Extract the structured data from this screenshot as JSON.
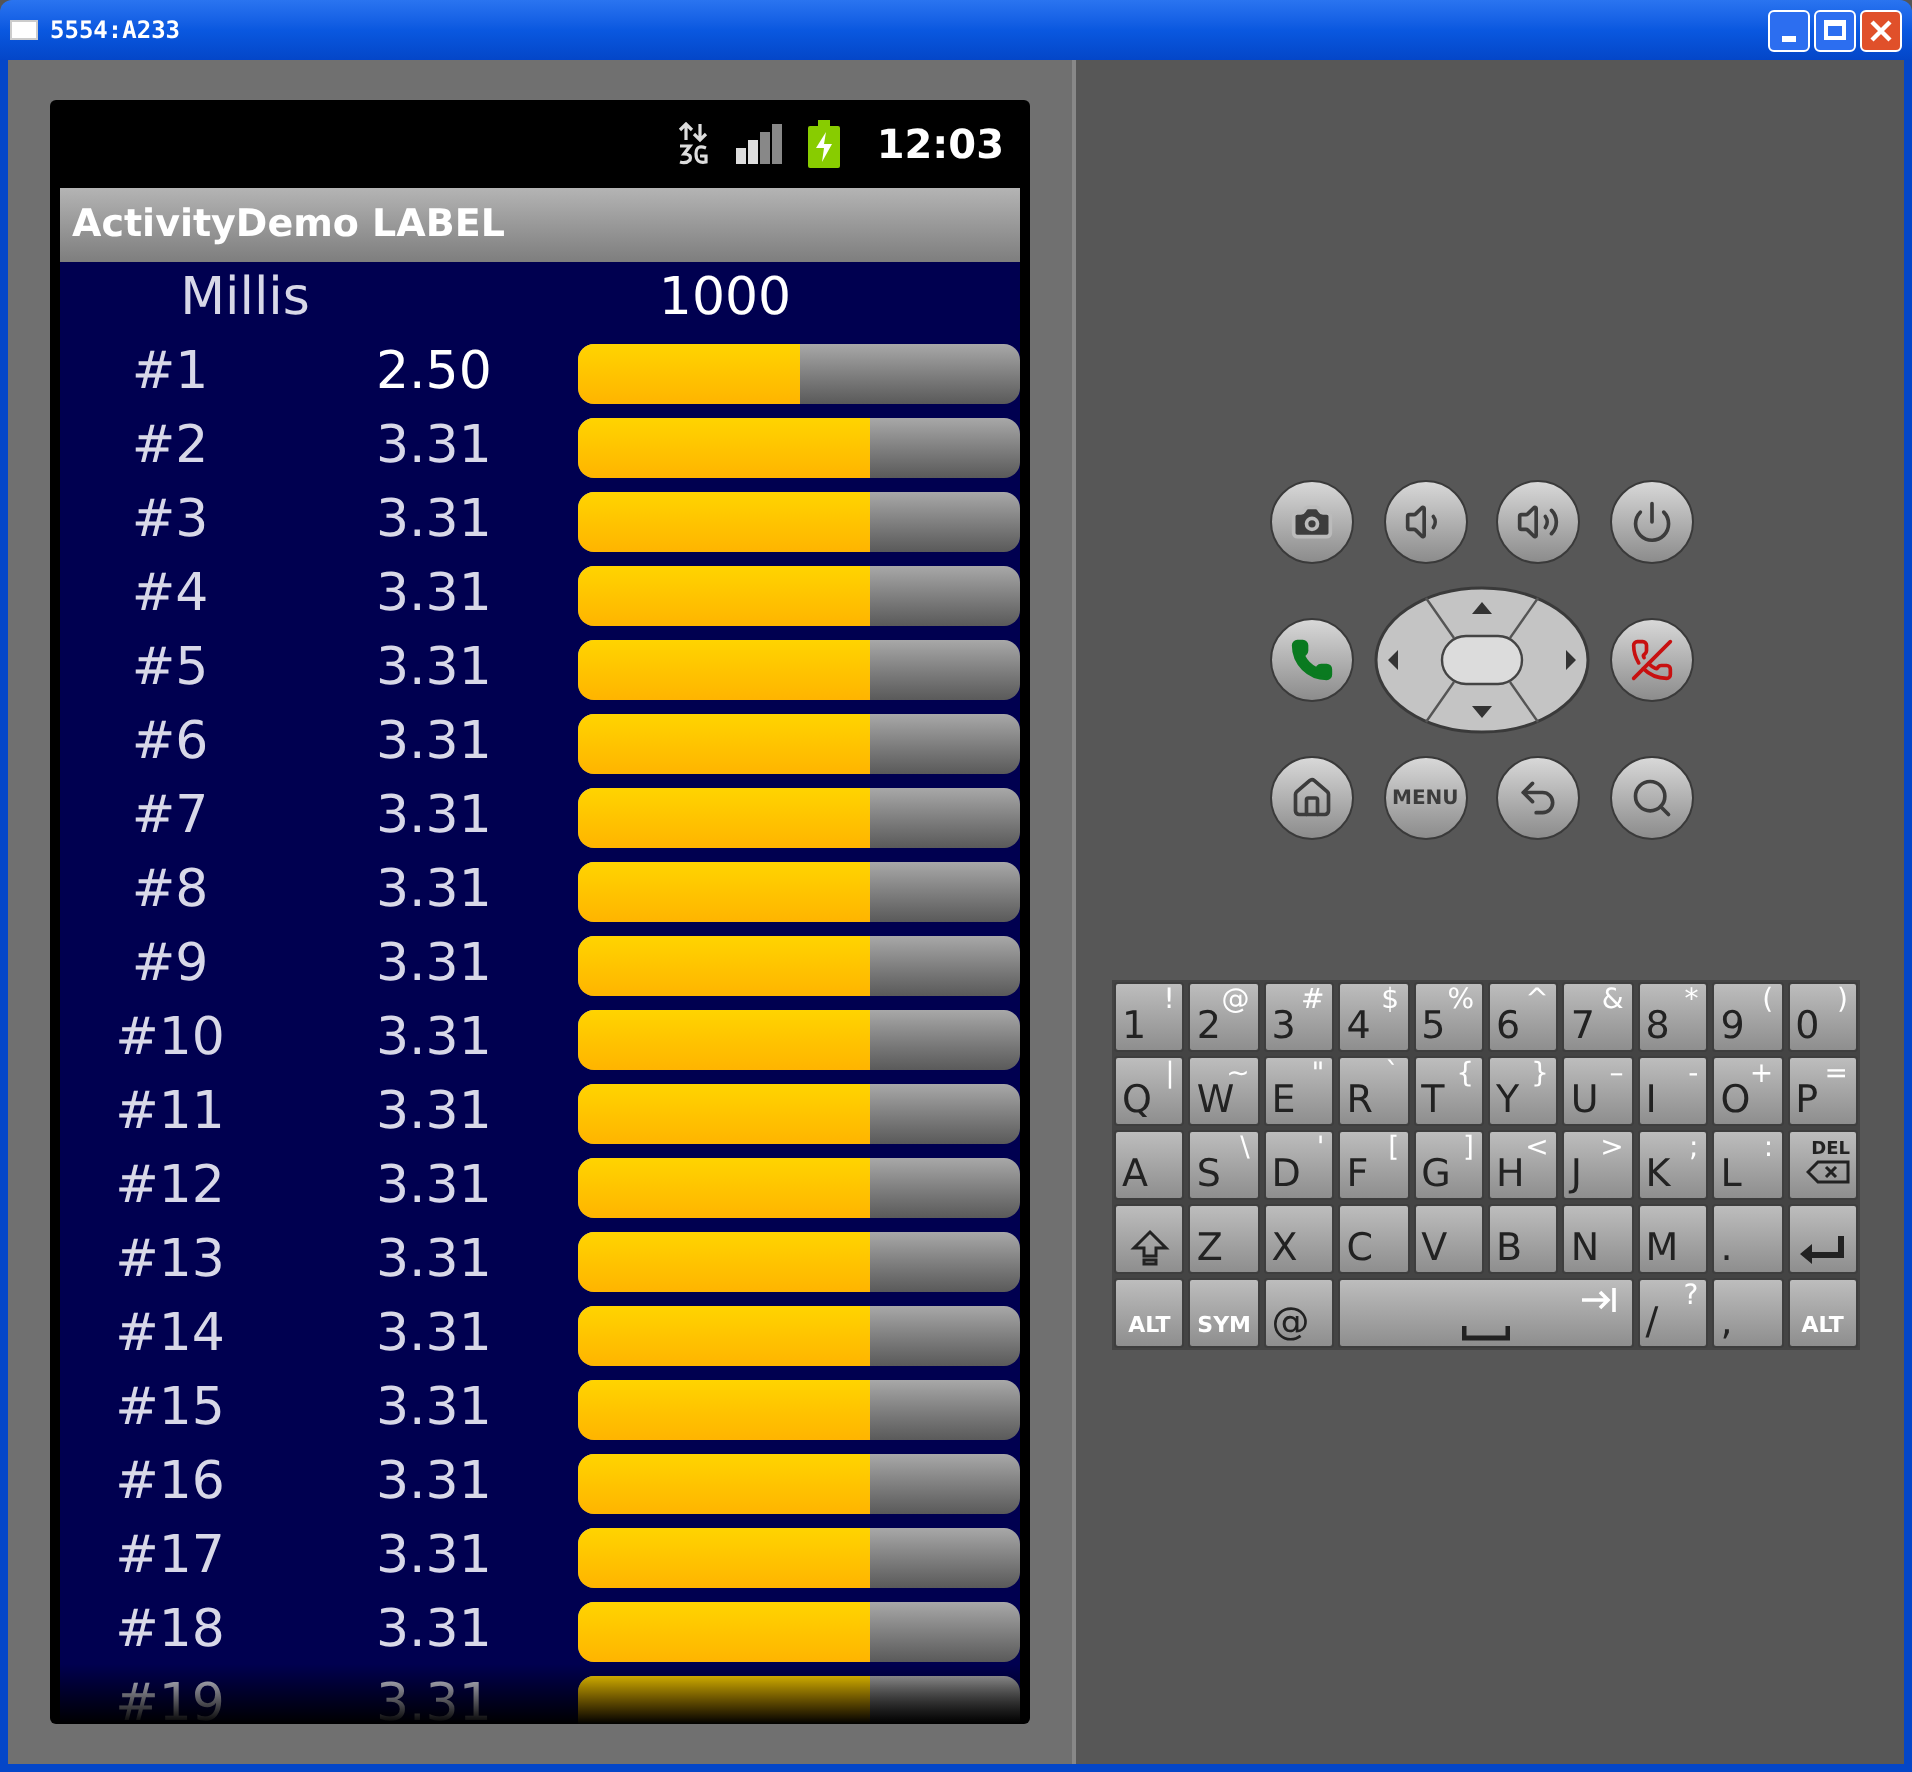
{
  "window": {
    "title": "5554:A233"
  },
  "status_bar": {
    "time": "12:03"
  },
  "app_bar": {
    "title": "ActivityDemo LABEL"
  },
  "header": {
    "label": "Millis",
    "value": "1000"
  },
  "rows": [
    {
      "label": "#1",
      "value": "2.50",
      "level": 0.5,
      "highlight": true
    },
    {
      "label": "#2",
      "value": "3.31",
      "level": 0.66,
      "highlight": false
    },
    {
      "label": "#3",
      "value": "3.31",
      "level": 0.66,
      "highlight": false
    },
    {
      "label": "#4",
      "value": "3.31",
      "level": 0.66,
      "highlight": false
    },
    {
      "label": "#5",
      "value": "3.31",
      "level": 0.66,
      "highlight": false
    },
    {
      "label": "#6",
      "value": "3.31",
      "level": 0.66,
      "highlight": false
    },
    {
      "label": "#7",
      "value": "3.31",
      "level": 0.66,
      "highlight": false
    },
    {
      "label": "#8",
      "value": "3.31",
      "level": 0.66,
      "highlight": false
    },
    {
      "label": "#9",
      "value": "3.31",
      "level": 0.66,
      "highlight": false
    },
    {
      "label": "#10",
      "value": "3.31",
      "level": 0.66,
      "highlight": false
    },
    {
      "label": "#11",
      "value": "3.31",
      "level": 0.66,
      "highlight": false
    },
    {
      "label": "#12",
      "value": "3.31",
      "level": 0.66,
      "highlight": false
    },
    {
      "label": "#13",
      "value": "3.31",
      "level": 0.66,
      "highlight": false
    },
    {
      "label": "#14",
      "value": "3.31",
      "level": 0.66,
      "highlight": false
    },
    {
      "label": "#15",
      "value": "3.31",
      "level": 0.66,
      "highlight": false
    },
    {
      "label": "#16",
      "value": "3.31",
      "level": 0.66,
      "highlight": false
    },
    {
      "label": "#17",
      "value": "3.31",
      "level": 0.66,
      "highlight": false
    },
    {
      "label": "#18",
      "value": "3.31",
      "level": 0.66,
      "highlight": false
    },
    {
      "label": "#19",
      "value": "3.31",
      "level": 0.66,
      "highlight": false
    }
  ],
  "hardware_buttons": [
    {
      "kind": "camera"
    },
    {
      "kind": "volume-down"
    },
    {
      "kind": "volume-up"
    },
    {
      "kind": "power"
    },
    {
      "kind": "call"
    },
    {
      "kind": "dpad"
    },
    {
      "kind": "end-call"
    },
    {
      "kind": "home"
    },
    {
      "kind": "menu",
      "label": "MENU"
    },
    {
      "kind": "back"
    },
    {
      "kind": "search"
    }
  ],
  "keyboard": [
    [
      {
        "kind": "char",
        "main": "1",
        "alt": "!"
      },
      {
        "kind": "char",
        "main": "2",
        "alt": "@"
      },
      {
        "kind": "char",
        "main": "3",
        "alt": "#"
      },
      {
        "kind": "char",
        "main": "4",
        "alt": "$"
      },
      {
        "kind": "char",
        "main": "5",
        "alt": "%"
      },
      {
        "kind": "char",
        "main": "6",
        "alt": "^"
      },
      {
        "kind": "char",
        "main": "7",
        "alt": "&"
      },
      {
        "kind": "char",
        "main": "8",
        "alt": "*"
      },
      {
        "kind": "char",
        "main": "9",
        "alt": "("
      },
      {
        "kind": "char",
        "main": "0",
        "alt": ")"
      }
    ],
    [
      {
        "kind": "char",
        "main": "Q",
        "alt": "|"
      },
      {
        "kind": "char",
        "main": "W",
        "alt": "~"
      },
      {
        "kind": "char",
        "main": "E",
        "alt": "\""
      },
      {
        "kind": "char",
        "main": "R",
        "alt": "`"
      },
      {
        "kind": "char",
        "main": "T",
        "alt": "{"
      },
      {
        "kind": "char",
        "main": "Y",
        "alt": "}"
      },
      {
        "kind": "char",
        "main": "U",
        "alt": "–"
      },
      {
        "kind": "char",
        "main": "I",
        "alt": "-"
      },
      {
        "kind": "char",
        "main": "O",
        "alt": "+"
      },
      {
        "kind": "char",
        "main": "P",
        "alt": "="
      }
    ],
    [
      {
        "kind": "char",
        "main": "A"
      },
      {
        "kind": "char",
        "main": "S",
        "alt": "\\"
      },
      {
        "kind": "char",
        "main": "D",
        "alt": "'"
      },
      {
        "kind": "char",
        "main": "F",
        "alt": "["
      },
      {
        "kind": "char",
        "main": "G",
        "alt": "]"
      },
      {
        "kind": "char",
        "main": "H",
        "alt": "<"
      },
      {
        "kind": "char",
        "main": "J",
        "alt": ">"
      },
      {
        "kind": "char",
        "main": "K",
        "alt": ";"
      },
      {
        "kind": "char",
        "main": "L",
        "alt": ":"
      },
      {
        "kind": "del",
        "main": "DEL"
      }
    ],
    [
      {
        "kind": "shift"
      },
      {
        "kind": "char",
        "main": "Z"
      },
      {
        "kind": "char",
        "main": "X"
      },
      {
        "kind": "char",
        "main": "C"
      },
      {
        "kind": "char",
        "main": "V"
      },
      {
        "kind": "char",
        "main": "B"
      },
      {
        "kind": "char",
        "main": "N"
      },
      {
        "kind": "char",
        "main": "M"
      },
      {
        "kind": "char",
        "main": "."
      },
      {
        "kind": "enter"
      }
    ],
    [
      {
        "kind": "label",
        "main": "ALT"
      },
      {
        "kind": "label",
        "main": "SYM"
      },
      {
        "kind": "char",
        "main": "@"
      },
      {
        "kind": "space"
      },
      {
        "kind": "char",
        "main": "/",
        "alt": "?"
      },
      {
        "kind": "char",
        "main": ","
      },
      {
        "kind": "label",
        "main": "ALT"
      }
    ]
  ]
}
